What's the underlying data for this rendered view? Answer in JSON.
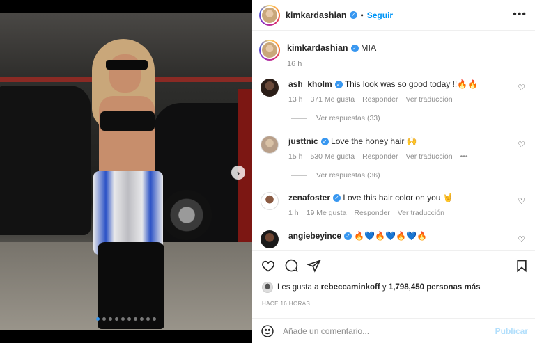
{
  "post": {
    "author": "kimkardashian",
    "follow_sep": "•",
    "follow_label": "Seguir",
    "more_icon": "more-horizontal-icon",
    "caption_text": "MIA",
    "caption_time": "16 h",
    "carousel_total": 10,
    "carousel_active_index": 0
  },
  "comments": [
    {
      "user": "ash_kholm",
      "text": "This look was so good today !!🔥🔥",
      "time": "13 h",
      "likes": "371 Me gusta",
      "reply": "Responder",
      "translate": "Ver traducción",
      "replies": "Ver respuestas (33)"
    },
    {
      "user": "justtnic",
      "text": "Love the honey hair 🙌",
      "time": "15 h",
      "likes": "530 Me gusta",
      "reply": "Responder",
      "translate": "Ver traducción",
      "extra": "•••",
      "replies": "Ver respuestas (36)"
    },
    {
      "user": "zenafoster",
      "text": "Love this hair color on you 🤘",
      "time": "1 h",
      "likes": "19 Me gusta",
      "reply": "Responder",
      "translate": "Ver traducción"
    },
    {
      "user": "angiebeyince",
      "text": "🔥💙🔥💙🔥💙🔥"
    }
  ],
  "likes": {
    "prefix": "Les gusta a",
    "user": "rebeccaminkoff",
    "conj": "y",
    "count": "1,798,450 personas más"
  },
  "ago": "HACE 16 HORAS",
  "composer": {
    "placeholder": "Añade un comentario...",
    "publish": "Publicar"
  },
  "colors": {
    "accent": "#0095f6",
    "verified": "#3897f0",
    "muted": "#8e8e8e",
    "publish_disabled": "#b2dffc"
  }
}
